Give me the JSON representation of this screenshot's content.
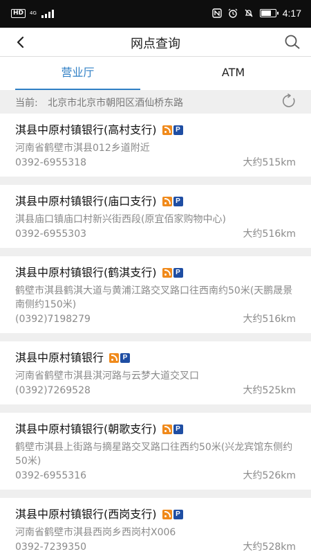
{
  "statusbar": {
    "hd": "HD",
    "network": "4G",
    "time": "4:17",
    "battery_level": 0.7
  },
  "navbar": {
    "title": "网点查询",
    "back_icon": "chevron-left-icon",
    "search_icon": "search-icon"
  },
  "tabs": [
    {
      "label": "营业厅",
      "active": true
    },
    {
      "label": "ATM",
      "active": false
    }
  ],
  "location": {
    "prefix": "当前:",
    "address": "北京市北京市朝阳区酒仙桥东路"
  },
  "branches": [
    {
      "name": "淇县中原村镇银行(高村支行)",
      "address": "河南省鹤壁市淇县012乡道附近",
      "phone": "0392-6955318",
      "distance": "大约515km"
    },
    {
      "name": "淇县中原村镇银行(庙口支行)",
      "address": "淇县庙口镇庙口村新兴街西段(原宜佰家购物中心)",
      "phone": "0392-6955303",
      "distance": "大约516km"
    },
    {
      "name": "淇县中原村镇银行(鹤淇支行)",
      "address": "鹤壁市淇县鹤淇大道与黄浦江路交叉路口往西南约50米(天鹏晟景南侧约150米)",
      "phone": "(0392)7198279",
      "distance": "大约516km"
    },
    {
      "name": "淇县中原村镇银行",
      "address": "河南省鹤壁市淇县淇河路与云梦大道交叉口",
      "phone": "(0392)7269528",
      "distance": "大约525km"
    },
    {
      "name": "淇县中原村镇银行(朝歌支行)",
      "address": "鹤壁市淇县上街路与摘星路交叉路口往西约50米(兴龙宾馆东侧约50米)",
      "phone": "0392-6955316",
      "distance": "大约526km"
    },
    {
      "name": "淇县中原村镇银行(西岗支行)",
      "address": "河南省鹤壁市淇县西岗乡西岗村X006",
      "phone": "0392-7239350",
      "distance": "大约528km"
    }
  ],
  "badges": {
    "rss": "rss-icon",
    "parking": "P"
  }
}
